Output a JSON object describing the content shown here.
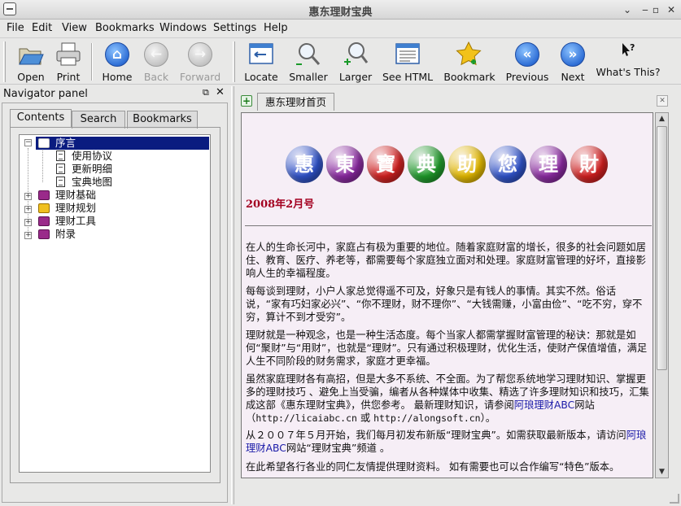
{
  "window": {
    "title": "惠东理财宝典",
    "controls": [
      "⌄",
      "‒",
      "▫",
      "✕"
    ]
  },
  "menu": [
    "File",
    "Edit",
    "View",
    "Bookmarks",
    "Windows",
    "Settings",
    "Help"
  ],
  "toolbar": {
    "open": "Open",
    "print": "Print",
    "home": "Home",
    "back": "Back",
    "forward": "Forward",
    "locate": "Locate",
    "smaller": "Smaller",
    "larger": "Larger",
    "see_html": "See HTML",
    "bookmark": "Bookmark",
    "previous": "Previous",
    "next": "Next",
    "whats_this": "What's This?"
  },
  "navigator": {
    "title": "Navigator panel",
    "tabs": [
      "Contents",
      "Search",
      "Bookmarks"
    ],
    "tree": [
      {
        "label": "序言",
        "expanded": true,
        "selected": true,
        "children": [
          "使用协议",
          "更新明细",
          "宝典地图"
        ]
      },
      {
        "label": "理财基础",
        "expanded": false
      },
      {
        "label": "理财规划",
        "expanded": false
      },
      {
        "label": "理财工具",
        "expanded": false
      },
      {
        "label": "附录",
        "expanded": false
      }
    ]
  },
  "document": {
    "tab_title": "惠东理财首页",
    "banner_chars": [
      "惠",
      "東",
      "寶",
      "典",
      "助",
      "您",
      "理",
      "財"
    ],
    "banner_colors": [
      "#2f52c8",
      "#8a2aa0",
      "#d02020",
      "#1f9a2a",
      "#e2b800",
      "#2f52c8",
      "#8a2aa0",
      "#d02020"
    ],
    "issue": "2008年2月号",
    "p1": "在人的生命长河中，家庭占有极为重要的地位。随着家庭财富的增长，很多的社会问题如居住、教育、医疗、养老等，都需要每个家庭独立面对和处理。家庭财富管理的好坏，直接影响人生的幸福程度。",
    "p2": "每每谈到理财，小户人家总觉得遥不可及，好象只是有钱人的事情。其实不然。俗话说，“家有巧妇家必兴”、“你不理财，财不理你”、“大钱需赚，小富由俭”、“吃不穷，穿不穷，算计不到才受穷”。",
    "p3": "理财就是一种观念，也是一种生活态度。每个当家人都需掌握财富管理的秘诀：那就是如何“聚财”与“用财”，也就是“理财”。只有通过积极理财，优化生活，使财产保值增值，满足人生不同阶段的财务需求，家庭才更幸福。",
    "p4_a": "虽然家庭理财各有高招，但是大多不系统、不全面。为了帮您系统地学习理财知识、掌握更多的理财技巧 、避免上当受骗，编者从各种媒体中收集、精选了许多理财知识和技巧，汇集成这部《惠东理财宝典》，供您参考。 最新理财知识，请参阅",
    "p4_link": "阿琅理财ABC",
    "p4_b": "网站（",
    "p4_url1": "http://licaiabc.cn",
    "p4_or": " 或 ",
    "p4_url2": "http://alongsoft.cn",
    "p4_c": "）。",
    "p5_a": "从２００７年５月开始，我们每月初发布新版“理财宝典”。如需获取最新版本，请访问",
    "p5_link": "阿琅理财ABC",
    "p5_b": "网站“理财宝典”频道 。",
    "p6": "在此希望各行各业的同仁友情提供理财资料。 如有需要也可以合作编写“特色”版本。"
  }
}
